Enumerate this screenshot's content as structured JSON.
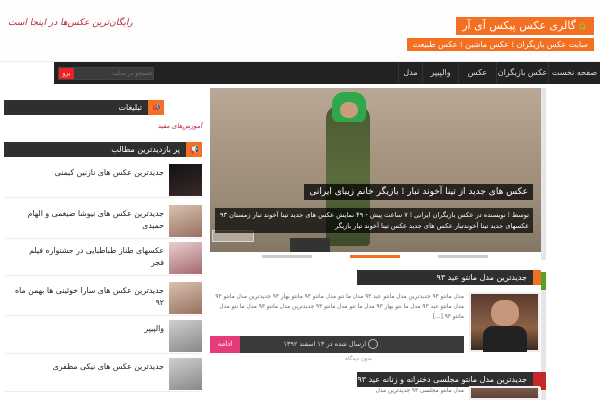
{
  "header": {
    "site_title": "گالری عکس پیکس آی آر",
    "subtitle": "سایت عکس بازیگران ⁞ عکس ماشین ⁞ عکس طبیعت",
    "logo_text": "رایگان‌ترین عکس‌ها در اینجا است"
  },
  "nav": {
    "items": [
      "صفحه نخست",
      "عکس بازیگران",
      "عکس خبری",
      "والپیپر",
      "مدل"
    ],
    "search_placeholder": "جستجو در سایت",
    "search_button": "برو"
  },
  "slider": {
    "title": "عکس های جدید از تینا آخوند تبار ⁞ بازیگر خانم زیبای ایرانی",
    "excerpt": "توسط ⁞ نویسنده در عکس بازیگران ایرانی ⁞ ۷ ساعت پیش - ۴۹ نمایش عکس های جدید تینا آخوند تبار زمستان ۹۳ عکسهای جدید تینا آخوندتبار عکس های جدید عکس تینا آخوند تبار بازیگر"
  },
  "main": {
    "section1_title": "جدیدترین مدل مانتو عید ۹۳",
    "post1_excerpt": "مدل مانتو ۹۳ جدیدترین مدل مانتو عید ۹۳ مدل ما نتو مدل مانتو ۹۳ مانتو بهار ۹۳ جدیدترین مدل مانتو ۹۳ مدل مانتو عید ۹۳ مدل ما نتو بهار ۹۳ مدل ما نتو مدل مانتو ۹۳ جدیدترین مدل مانتو ۹۳ مدل ما نتو مدل مانتو ۹۳ [...]",
    "more_button": "ادامه مطلب",
    "post1_date": "ارسال شده در ۱۳ اسفند ۱۳۹۲",
    "post1_extra": "بدون دیدگاه",
    "section2_title": "جدیدترین مدل مانتو مجلسی دخترانه و زنانه عید ۹۳",
    "post2_excerpt": "مدل مانتو مجلسی ۹۳ جدیدترین مدل"
  },
  "sidebar": {
    "ads_title": "تبلیغات",
    "ads_text": "آموزش‌های مفید",
    "popular_title": "پر بازدیدترین مطالب",
    "items": [
      "جدیدترین عکس های نازنین کیمنی",
      "جدیدترین عکس های نیوشا ضیغمی و الهام حمیدی",
      "عکسهای طناز طباطبایی در جشنواره فیلم فجر",
      "جدیدترین عکس های سارا خوئینی ها بهمن ماه ۹۲",
      "والپیپر",
      "جدیدترین عکس های نیکی مظفری"
    ]
  },
  "colors": {
    "accent": "#f36f21",
    "nav_bg": "#222222",
    "section_head": "#2f2f2f",
    "more_button": "#e63b7a",
    "logo_red": "#b6263a"
  }
}
